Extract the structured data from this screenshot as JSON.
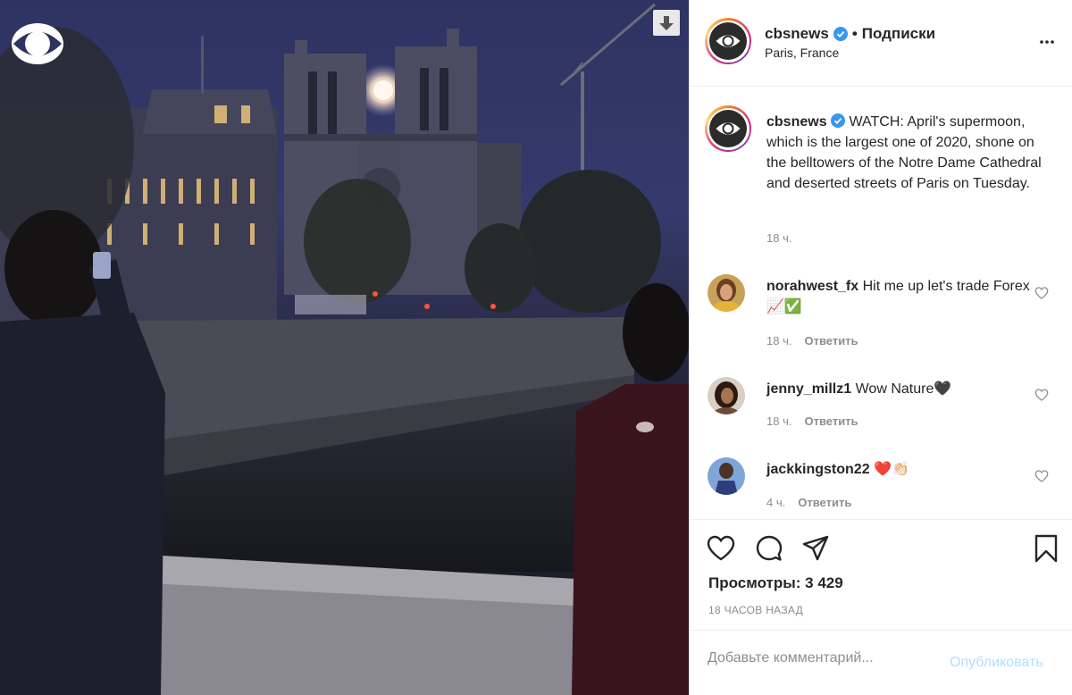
{
  "media": {
    "watermark_icon": "cbs-eye-logo",
    "download_icon": "arrow-down-icon"
  },
  "header": {
    "username": "cbsnews",
    "separator": "•",
    "follow_label": "Подписки",
    "location": "Paris, France",
    "more_icon": "more-options-icon"
  },
  "caption": {
    "username": "cbsnews",
    "text": "WATCH: April's supermoon, which is the largest one of 2020, shone on the belltowers of the Notre Dame Cathedral and deserted streets of Paris on Tuesday.",
    "time": "18 ч."
  },
  "comments": [
    {
      "username": "norahwest_fx",
      "text": "Hit me up let's trade Forex 📈✅",
      "time": "18 ч.",
      "reply": "Ответить"
    },
    {
      "username": "jenny_millz1",
      "text": "Wow Nature🖤",
      "time": "18 ч.",
      "reply": "Ответить"
    },
    {
      "username": "jackkingston22",
      "text": "❤️👏🏻",
      "time": "4 ч.",
      "reply": "Ответить"
    }
  ],
  "actions": {
    "views_label": "Просмотры: 3 429",
    "ago": "18 ЧАСОВ НАЗАД"
  },
  "comment_box": {
    "placeholder": "Добавьте комментарий...",
    "post_label": "Опубликовать"
  },
  "colors": {
    "accent_disabled": "#b2dffc",
    "verified": "#3897f0",
    "muted": "#8e8e8e"
  }
}
